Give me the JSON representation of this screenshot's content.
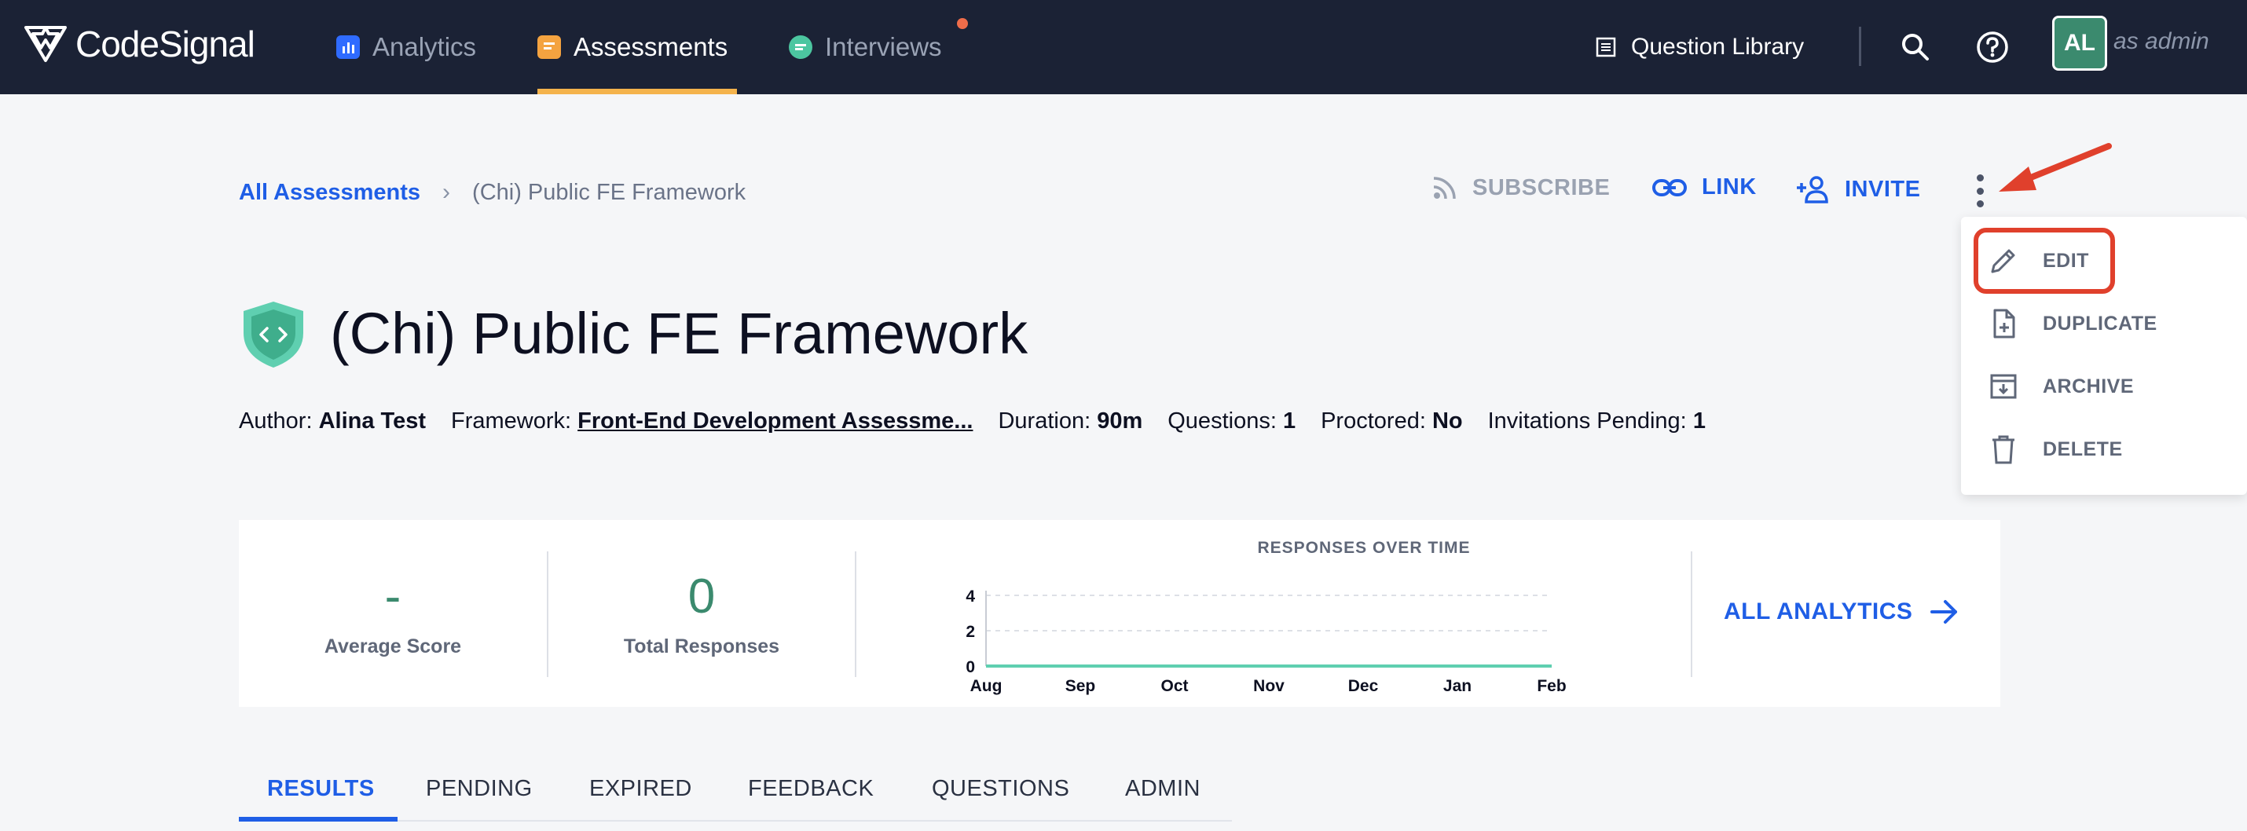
{
  "nav": {
    "logo_text": "CodeSignal",
    "tabs": [
      {
        "label": "Analytics",
        "icon": "bar-chart-icon",
        "color": "#2f6bff"
      },
      {
        "label": "Assessments",
        "icon": "assessment-icon",
        "color": "#f4a340",
        "active": true
      },
      {
        "label": "Interviews",
        "icon": "chat-icon",
        "color": "#4cc6a0",
        "has_notification": true
      }
    ],
    "question_library": "Question Library",
    "avatar_initials": "AL",
    "as_admin": "as admin"
  },
  "breadcrumb": {
    "root": "All Assessments",
    "current": "(Chi) Public FE Framework"
  },
  "actions": {
    "subscribe": "SUBSCRIBE",
    "link": "LINK",
    "invite": "INVITE"
  },
  "menu": {
    "items": [
      {
        "label": "EDIT",
        "icon": "pencil-icon",
        "highlighted": true
      },
      {
        "label": "DUPLICATE",
        "icon": "duplicate-file-icon"
      },
      {
        "label": "ARCHIVE",
        "icon": "archive-icon"
      },
      {
        "label": "DELETE",
        "icon": "trash-icon"
      }
    ]
  },
  "assessment": {
    "title": "(Chi) Public FE Framework",
    "meta": {
      "author_label": "Author:",
      "author": "Alina Test",
      "framework_label": "Framework:",
      "framework": "Front-End Development Assessme...",
      "duration_label": "Duration:",
      "duration": "90m",
      "questions_label": "Questions:",
      "questions": "1",
      "proctored_label": "Proctored:",
      "proctored": "No",
      "pending_label": "Invitations Pending:",
      "pending": "1"
    }
  },
  "stats": {
    "average_score": {
      "value": "-",
      "label": "Average Score"
    },
    "total_responses": {
      "value": "0",
      "label": "Total Responses"
    },
    "all_analytics": "ALL ANALYTICS"
  },
  "chart_data": {
    "type": "line",
    "title": "RESPONSES OVER TIME",
    "categories": [
      "Aug",
      "Sep",
      "Oct",
      "Nov",
      "Dec",
      "Jan",
      "Feb"
    ],
    "series": [
      {
        "values": [
          0,
          0,
          0,
          0,
          0,
          0,
          0
        ],
        "color": "#5fcfb0"
      }
    ],
    "yticks": [
      "0",
      "2",
      "4"
    ],
    "ylim": [
      0,
      4
    ],
    "grid": true
  },
  "tabs": [
    "RESULTS",
    "PENDING",
    "EXPIRED",
    "FEEDBACK",
    "QUESTIONS",
    "ADMIN"
  ]
}
